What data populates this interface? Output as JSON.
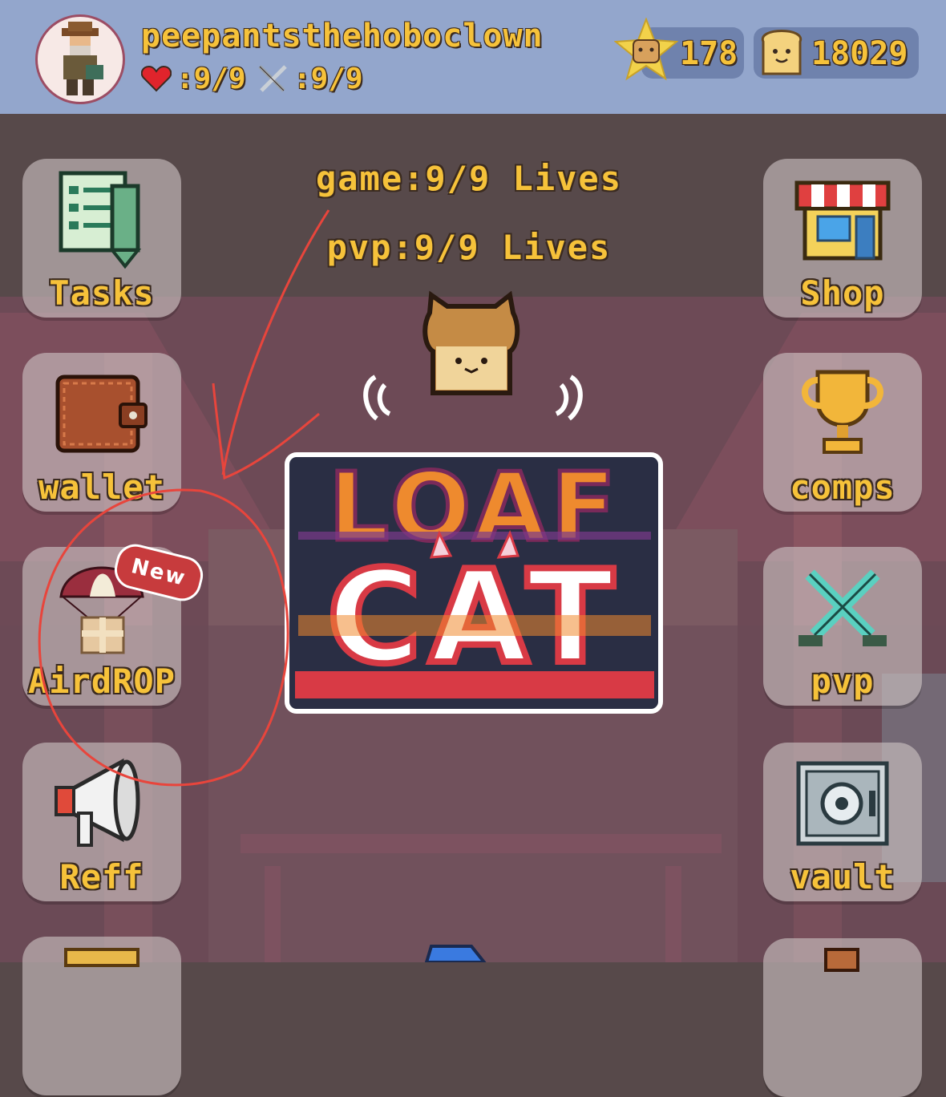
{
  "player": {
    "username": "peepantsthehoboclown",
    "hearts": ":9/9",
    "pvp_lives": ":9/9"
  },
  "currencies": {
    "stars": "178",
    "bread": "18029"
  },
  "lives_info": {
    "game": "game:9/9 Lives",
    "pvp": "pvp:9/9 Lives"
  },
  "logo": {
    "line1": "LOAF",
    "line2": "CAT"
  },
  "left_menu": [
    {
      "label": "Tasks",
      "icon": "tasks-icon"
    },
    {
      "label": "wallet",
      "icon": "wallet-icon"
    },
    {
      "label": "AirdROP",
      "icon": "airdrop-icon",
      "badge": "New"
    },
    {
      "label": "Reff",
      "icon": "megaphone-icon"
    }
  ],
  "right_menu": [
    {
      "label": "Shop",
      "icon": "shop-icon"
    },
    {
      "label": "comps",
      "icon": "trophy-icon"
    },
    {
      "label": "pvp",
      "icon": "crossed-swords-icon"
    },
    {
      "label": "vault",
      "icon": "vault-icon"
    }
  ],
  "colors": {
    "header": "#93a6cc",
    "label_gold": "#f6c23a",
    "annotation_red": "#e8453c",
    "badge_red": "#c73b3d"
  }
}
